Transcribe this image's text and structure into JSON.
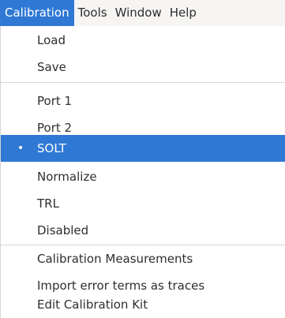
{
  "menubar": {
    "items": [
      {
        "label": "Calibration"
      },
      {
        "label": "Tools"
      },
      {
        "label": "Window"
      },
      {
        "label": "Help"
      }
    ]
  },
  "calibration_menu": {
    "items": [
      {
        "label": "Load"
      },
      {
        "label": "Save"
      },
      {
        "label": "Port 1"
      },
      {
        "label": "Port 2"
      },
      {
        "label": "SOLT",
        "checked": true
      },
      {
        "label": "Normalize"
      },
      {
        "label": "TRL"
      },
      {
        "label": "Disabled"
      },
      {
        "label": "Calibration Measurements"
      },
      {
        "label": "Import error terms as traces"
      },
      {
        "label": "Edit Calibration Kit"
      }
    ],
    "selected_bullet": "•"
  },
  "colors": {
    "accent": "#2f78d4",
    "menubar_bg": "#f6f5f4",
    "text": "#2e2e2e"
  }
}
